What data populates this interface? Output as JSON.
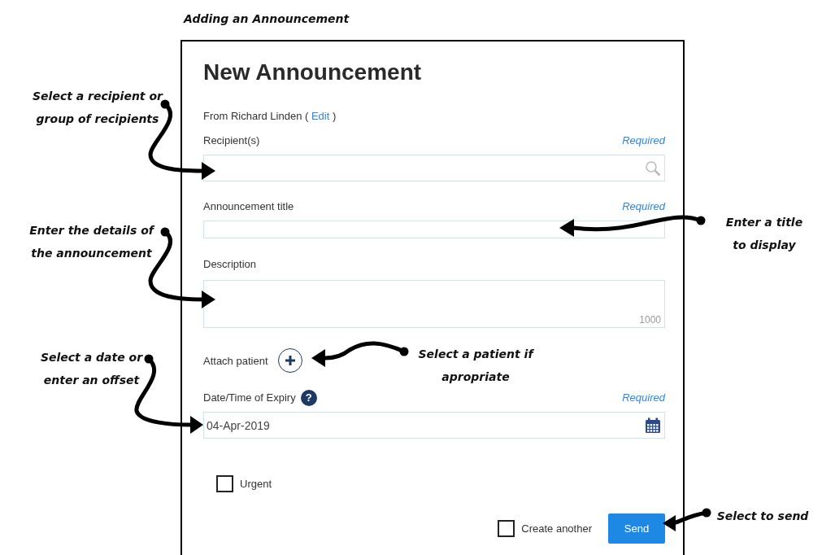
{
  "caption": "Adding an Announcement",
  "form": {
    "title": "New Announcement",
    "from_text": "From Richard Linden (",
    "edit_link": "Edit",
    "from_close": ")",
    "fields": [
      {
        "kind": "search",
        "label": "Recipient(s)",
        "required": "Required"
      },
      {
        "kind": "text",
        "label": "Announcement title",
        "required": "Required"
      },
      {
        "kind": "textarea",
        "label": "Description",
        "counter": "1000"
      },
      {
        "kind": "attach",
        "label": "Attach patient"
      },
      {
        "kind": "date",
        "label": "Date/Time of Expiry",
        "help": "?",
        "required": "Required",
        "value": "04-Apr-2019"
      }
    ],
    "urgent": {
      "label": "Urgent",
      "checked": false
    },
    "create_another": {
      "label": "Create another",
      "checked": false
    },
    "send_button": "Send"
  },
  "annotations": [
    {
      "lines": [
        "Select a recipient or",
        "group of recipients"
      ]
    },
    {
      "lines": [
        "Enter the details of",
        "the announcement"
      ]
    },
    {
      "lines": [
        "Select a date or",
        "enter an offset"
      ]
    },
    {
      "lines": [
        "Enter a title",
        "to display"
      ]
    },
    {
      "lines": [
        "Select a patient if",
        "apropriate"
      ]
    },
    {
      "lines": [
        "Select to send"
      ]
    }
  ]
}
